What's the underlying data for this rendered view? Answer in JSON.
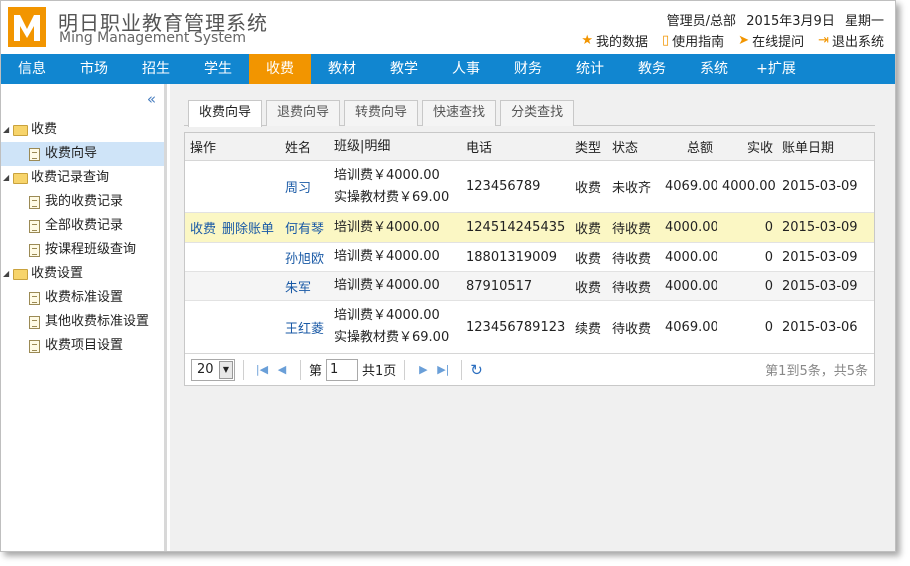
{
  "header": {
    "logo_letter": "M",
    "title": "明日职业教育管理系统",
    "subtitle": "Ming Management System",
    "user": "管理员/总部",
    "date": "2015年3月9日",
    "weekday": "星期一",
    "links": [
      {
        "label": "我的数据",
        "icon": "star-icon"
      },
      {
        "label": "使用指南",
        "icon": "book-icon"
      },
      {
        "label": "在线提问",
        "icon": "send-icon"
      },
      {
        "label": "退出系统",
        "icon": "exit-icon"
      }
    ]
  },
  "nav": {
    "items": [
      "信息",
      "市场",
      "招生",
      "学生",
      "收费",
      "教材",
      "教学",
      "人事",
      "财务",
      "统计",
      "教务",
      "系统",
      "+扩展"
    ],
    "active_index": 4
  },
  "sidebar": {
    "collapse_icon": "«",
    "groups": [
      {
        "label": "收费",
        "items": [
          "收费向导"
        ]
      },
      {
        "label": "收费记录查询",
        "items": [
          "我的收费记录",
          "全部收费记录",
          "按课程班级查询"
        ]
      },
      {
        "label": "收费设置",
        "items": [
          "收费标准设置",
          "其他收费标准设置",
          "收费项目设置"
        ]
      }
    ],
    "selected": "收费向导"
  },
  "tabs": [
    "收费向导",
    "退费向导",
    "转费向导",
    "快速查找",
    "分类查找"
  ],
  "table": {
    "headers": {
      "op": "操作",
      "name": "姓名",
      "cls": "班级|明细",
      "tel": "电话",
      "type": "类型",
      "stat": "状态",
      "total": "总额",
      "paid": "实收",
      "date": "账单日期"
    },
    "rows": [
      {
        "op1": "",
        "op2": "",
        "name": "周习",
        "cls1": "培训费￥4000.00",
        "cls2": "实操教材费￥69.00",
        "tel": "123456789",
        "type": "收费",
        "stat": "未收齐",
        "total": "4069.00",
        "paid": "4000.00",
        "date": "2015-03-09"
      },
      {
        "op1": "收费",
        "op2": "删除账单",
        "name": "何有琴",
        "cls1": "培训费￥4000.00",
        "cls2": "",
        "tel": "124514245435",
        "type": "收费",
        "stat": "待收费",
        "total": "4000.00",
        "paid": "0",
        "date": "2015-03-09"
      },
      {
        "op1": "",
        "op2": "",
        "name": "孙旭欧",
        "cls1": "培训费￥4000.00",
        "cls2": "",
        "tel": "18801319009",
        "type": "收费",
        "stat": "待收费",
        "total": "4000.00",
        "paid": "0",
        "date": "2015-03-09"
      },
      {
        "op1": "",
        "op2": "",
        "name": "朱军",
        "cls1": "培训费￥4000.00",
        "cls2": "",
        "tel": "87910517",
        "type": "收费",
        "stat": "待收费",
        "total": "4000.00",
        "paid": "0",
        "date": "2015-03-09"
      },
      {
        "op1": "",
        "op2": "",
        "name": "王红菱",
        "cls1": "培训费￥4000.00",
        "cls2": "实操教材费￥69.00",
        "tel": "123456789123",
        "type": "续费",
        "stat": "待收费",
        "total": "4069.00",
        "paid": "0",
        "date": "2015-03-06"
      }
    ]
  },
  "pager": {
    "page_size": "20",
    "page_prefix": "第",
    "page_value": "1",
    "page_suffix": "共1页",
    "info": "第1到5条，共5条"
  },
  "colors": {
    "nav_bg": "#1186d0",
    "nav_active": "#f29500",
    "link": "#1a5aa6",
    "highlight_row": "#fbf7c4",
    "selected_tree": "#cfe4f8"
  }
}
